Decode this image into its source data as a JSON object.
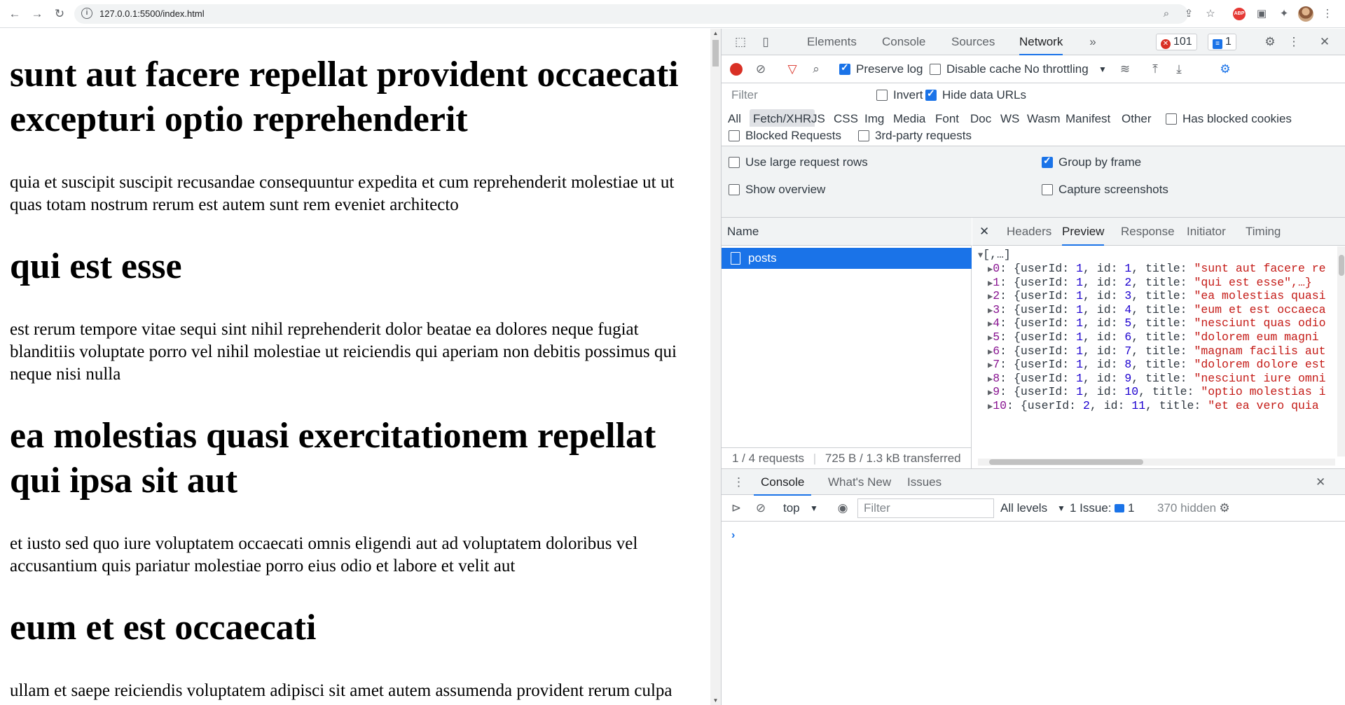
{
  "browser": {
    "url": "127.0.0.1:5500/index.html",
    "abp_label": "ABP"
  },
  "page": {
    "posts": [
      {
        "title": "sunt aut facere repellat provident occaecati excepturi optio reprehenderit",
        "body": "quia et suscipit suscipit recusandae consequuntur expedita et cum reprehenderit molestiae ut ut quas totam nostrum rerum est autem sunt rem eveniet architecto"
      },
      {
        "title": "qui est esse",
        "body": "est rerum tempore vitae sequi sint nihil reprehenderit dolor beatae ea dolores neque fugiat blanditiis voluptate porro vel nihil molestiae ut reiciendis qui aperiam non debitis possimus qui neque nisi nulla"
      },
      {
        "title": "ea molestias quasi exercitationem repellat qui ipsa sit aut",
        "body": "et iusto sed quo iure voluptatem occaecati omnis eligendi aut ad voluptatem doloribus vel accusantium quis pariatur molestiae porro eius odio et labore et velit aut"
      },
      {
        "title": "eum et est occaecati",
        "body": "ullam et saepe reiciendis voluptatem adipisci sit amet autem assumenda provident rerum culpa quis hic commodi nesciunt rem tenetur doloremque ipsam iure quis sunt"
      }
    ]
  },
  "devtools": {
    "tabs": [
      "Elements",
      "Console",
      "Sources",
      "Network"
    ],
    "active_tab": "Network",
    "more_tabs": "»",
    "error_count": "101",
    "message_count": "1",
    "network": {
      "preserve_log": "Preserve log",
      "disable_cache": "Disable cache",
      "throttling": "No throttling",
      "filter_placeholder": "Filter",
      "invert": "Invert",
      "hide_data_urls": "Hide data URLs",
      "types": [
        "All",
        "Fetch/XHR",
        "JS",
        "CSS",
        "Img",
        "Media",
        "Font",
        "Doc",
        "WS",
        "Wasm",
        "Manifest",
        "Other"
      ],
      "active_type": "Fetch/XHR",
      "has_blocked_cookies": "Has blocked cookies",
      "blocked_requests": "Blocked Requests",
      "third_party": "3rd-party requests",
      "large_rows": "Use large request rows",
      "group_by_frame": "Group by frame",
      "show_overview": "Show overview",
      "capture_screenshots": "Capture screenshots",
      "name_header": "Name",
      "request_name": "posts",
      "footer_requests": "1 / 4 requests",
      "footer_transferred": "725 B / 1.3 kB transferred",
      "detail_tabs": [
        "Headers",
        "Preview",
        "Response",
        "Initiator",
        "Timing"
      ],
      "active_detail_tab": "Preview",
      "preview_root": "[,…]",
      "preview_lines": [
        {
          "idx": "0",
          "pre": "{userId: ",
          "u": "1",
          "mid": ", id: ",
          "id": "1",
          "post": ", title: ",
          "title": "\"sunt aut facere re"
        },
        {
          "idx": "1",
          "pre": "{userId: ",
          "u": "1",
          "mid": ", id: ",
          "id": "2",
          "post": ", title: ",
          "title": "\"qui est esse\",…}"
        },
        {
          "idx": "2",
          "pre": "{userId: ",
          "u": "1",
          "mid": ", id: ",
          "id": "3",
          "post": ", title: ",
          "title": "\"ea molestias quasi"
        },
        {
          "idx": "3",
          "pre": "{userId: ",
          "u": "1",
          "mid": ", id: ",
          "id": "4",
          "post": ", title: ",
          "title": "\"eum et est occaeca"
        },
        {
          "idx": "4",
          "pre": "{userId: ",
          "u": "1",
          "mid": ", id: ",
          "id": "5",
          "post": ", title: ",
          "title": "\"nesciunt quas odio"
        },
        {
          "idx": "5",
          "pre": "{userId: ",
          "u": "1",
          "mid": ", id: ",
          "id": "6",
          "post": ", title: ",
          "title": "\"dolorem eum magni"
        },
        {
          "idx": "6",
          "pre": "{userId: ",
          "u": "1",
          "mid": ", id: ",
          "id": "7",
          "post": ", title: ",
          "title": "\"magnam facilis aut"
        },
        {
          "idx": "7",
          "pre": "{userId: ",
          "u": "1",
          "mid": ", id: ",
          "id": "8",
          "post": ", title: ",
          "title": "\"dolorem dolore est"
        },
        {
          "idx": "8",
          "pre": "{userId: ",
          "u": "1",
          "mid": ", id: ",
          "id": "9",
          "post": ", title: ",
          "title": "\"nesciunt iure omni"
        },
        {
          "idx": "9",
          "pre": "{userId: ",
          "u": "1",
          "mid": ", id: ",
          "id": "10",
          "post": ", title: ",
          "title": "\"optio molestias i"
        },
        {
          "idx": "10",
          "pre": "{userId: ",
          "u": "2",
          "mid": ", id: ",
          "id": "11",
          "post": ", title: ",
          "title": "\"et ea vero quia"
        }
      ]
    },
    "console": {
      "tabs": [
        "Console",
        "What's New",
        "Issues"
      ],
      "active_tab": "Console",
      "context": "top",
      "filter_placeholder": "Filter",
      "levels": "All levels",
      "issues_label": "1 Issue:",
      "issues_count": "1",
      "hidden": "370 hidden",
      "prompt": "›"
    }
  }
}
